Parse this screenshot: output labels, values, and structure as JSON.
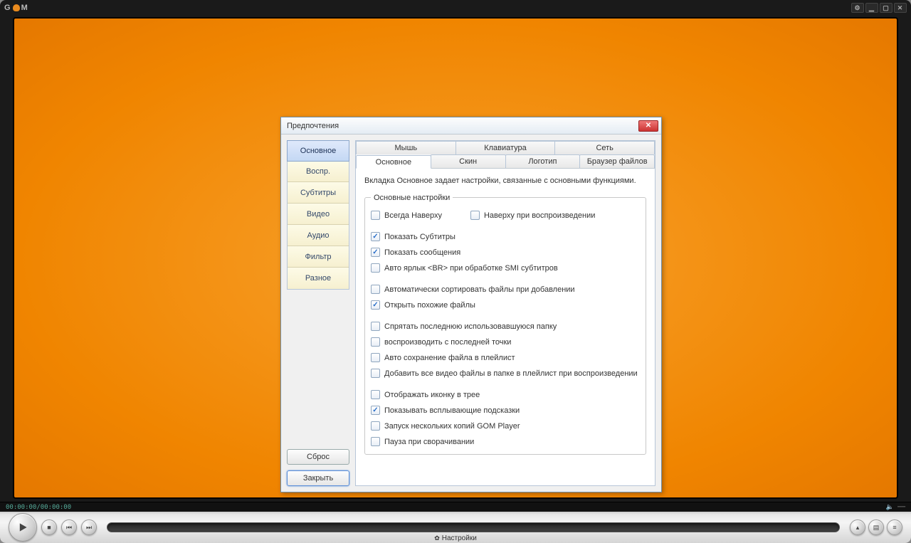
{
  "player": {
    "brand_part1": "G",
    "brand_part2": "M",
    "timecode": "00:00:00/00:00:00",
    "status_text": "Настройки"
  },
  "dialog": {
    "title": "Предпочтения",
    "sidebar": {
      "tabs": [
        "Основное",
        "Воспр.",
        "Субтитры",
        "Видео",
        "Аудио",
        "Фильтр",
        "Разное"
      ],
      "active_index": 0,
      "reset_label": "Сброс",
      "close_label": "Закрыть"
    },
    "top_tabs": {
      "row1": [
        "Мышь",
        "Клавиатура",
        "Сеть"
      ],
      "row2": [
        "Основное",
        "Скин",
        "Логотип",
        "Браузер файлов"
      ],
      "active": "Основное"
    },
    "description": "Вкладка Основное задает настройки, связанные с основными функциями.",
    "fieldset_legend": "Основные настройки",
    "checkboxes": [
      {
        "label": "Всегда Наверху",
        "checked": false,
        "pair_with": "Наверху при воспроизведении",
        "pair_checked": false
      },
      {
        "gap": true
      },
      {
        "label": "Показать Субтитры",
        "checked": true
      },
      {
        "label": "Показать сообщения",
        "checked": true
      },
      {
        "label": "Авто ярлык <BR> при обработке SMI субтитров",
        "checked": false
      },
      {
        "gap": true
      },
      {
        "label": "Автоматически сортировать файлы при добавлении",
        "checked": false
      },
      {
        "label": "Открыть похожие файлы",
        "checked": true
      },
      {
        "gap": true
      },
      {
        "label": "Спрятать последнюю использовавшуюся папку",
        "checked": false
      },
      {
        "label": "воспроизводить с последней точки",
        "checked": false
      },
      {
        "label": "Авто сохранение файла в плейлист",
        "checked": false
      },
      {
        "label": "Добавить все видео файлы в папке в плейлист при воспроизведении",
        "checked": false
      },
      {
        "gap": true
      },
      {
        "label": "Отображать иконку в трее",
        "checked": false
      },
      {
        "label": "Показывать всплывающие подсказки",
        "checked": true
      },
      {
        "label": "Запуск нескольких копий GOM Player",
        "checked": false
      },
      {
        "label": "Пауза при сворачивании",
        "checked": false
      }
    ]
  }
}
